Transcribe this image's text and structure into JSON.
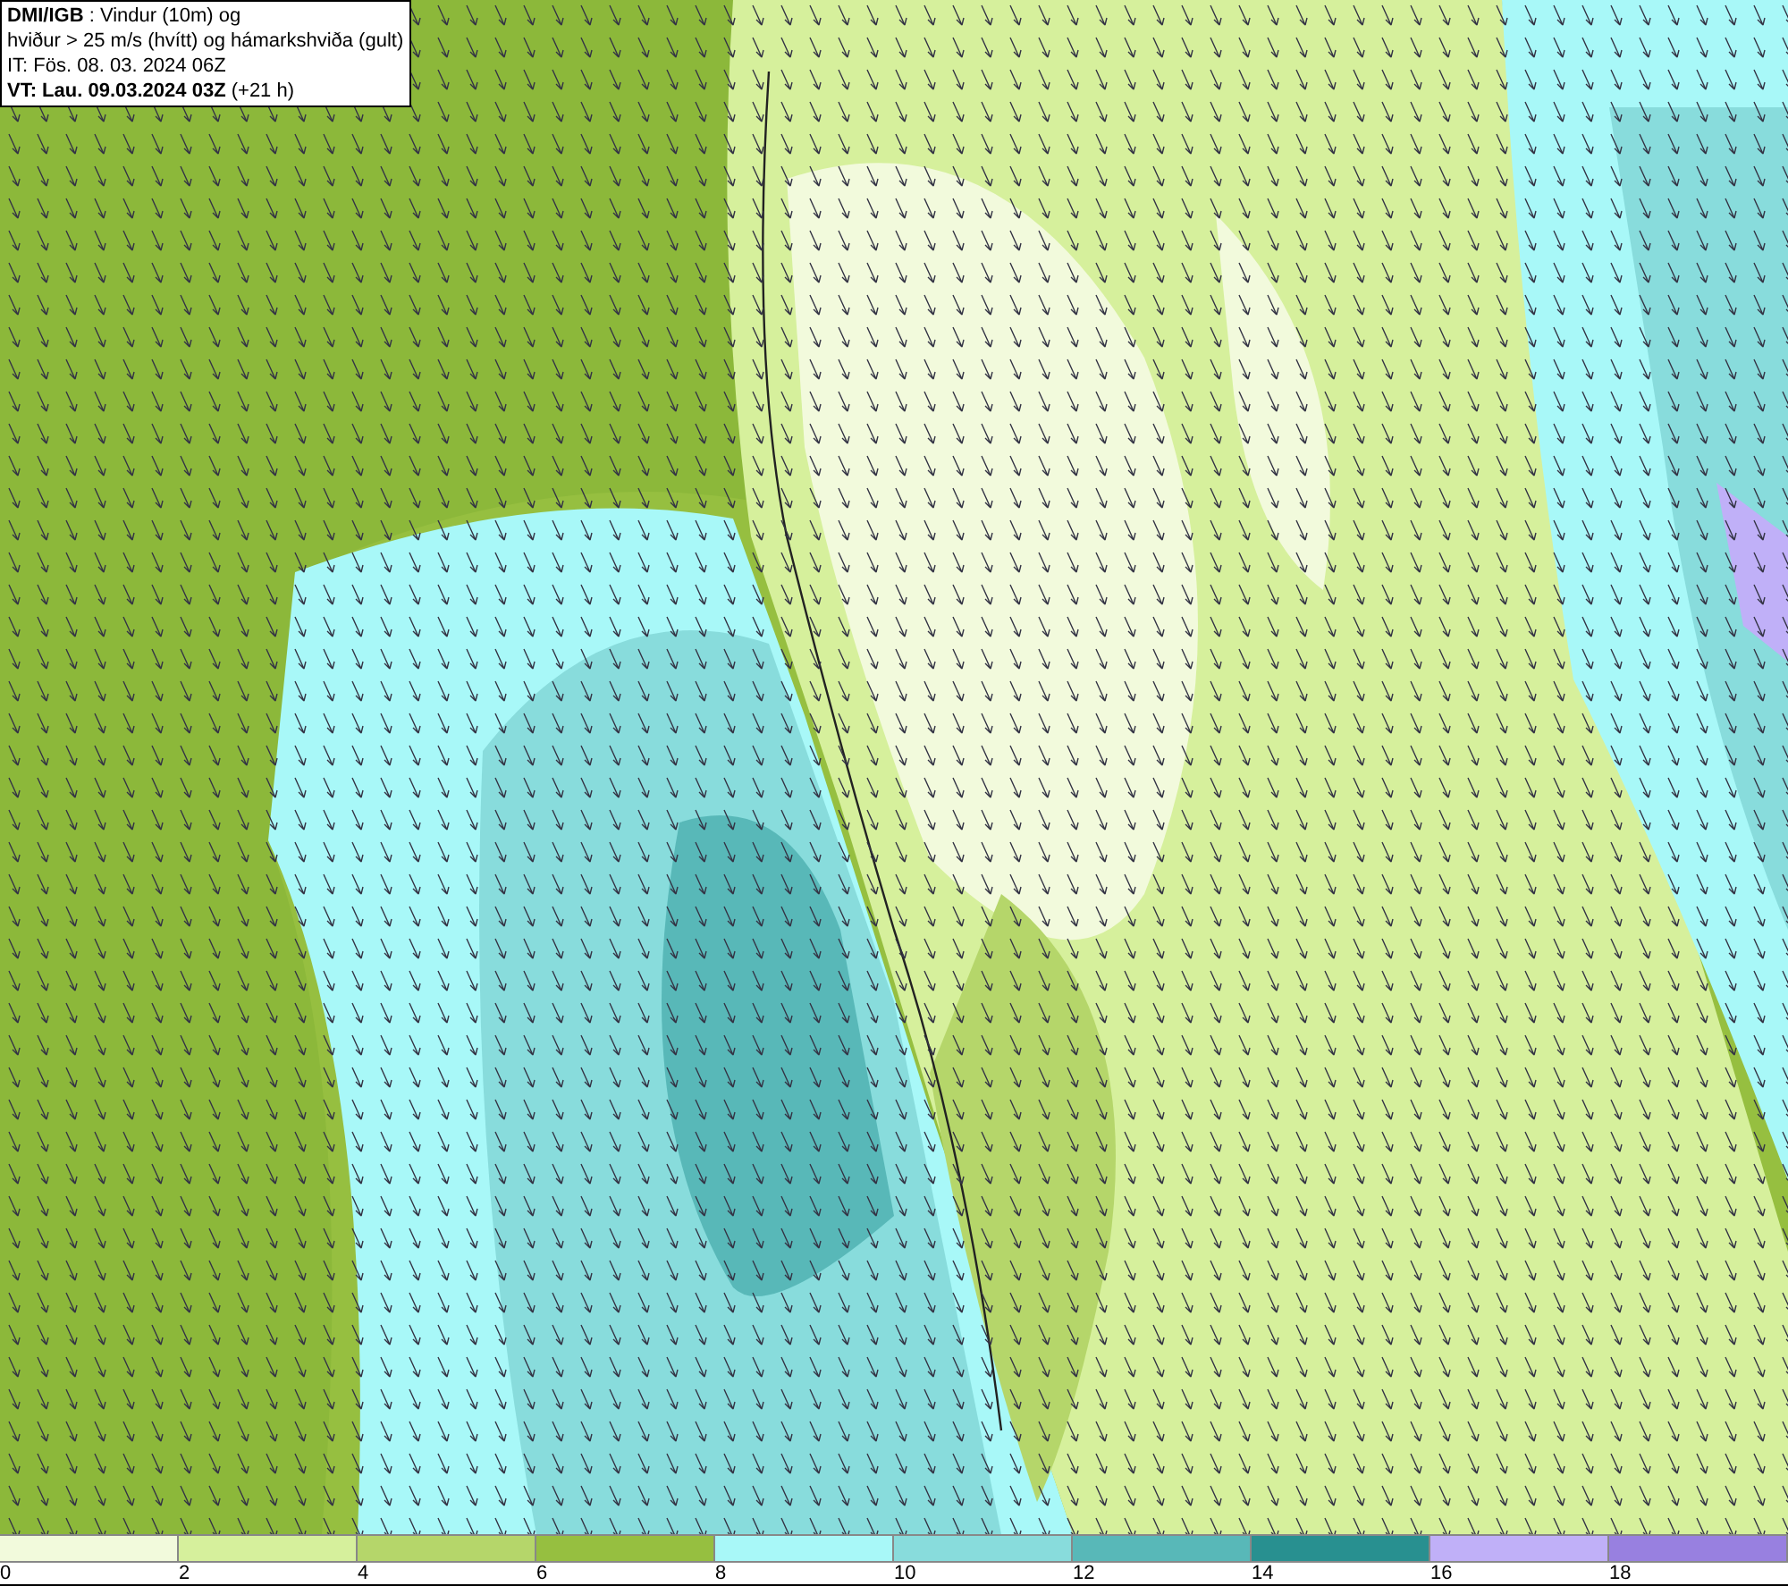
{
  "title_box": {
    "lines": [
      "**DMI/IGB** : Vindur (10m) og",
      "hviður > 25 m/s (hvítt) og hámarkshviða (gult)",
      "IT: Fös. 08. 03. 2024 06Z",
      "**VT: Lau. 09.03.2024 03Z** (+21 h)"
    ]
  },
  "legend": [
    {
      "label": "0",
      "color": "#f2fadc"
    },
    {
      "label": "2",
      "color": "#d6f09c"
    },
    {
      "label": "4",
      "color": "#b5d66a"
    },
    {
      "label": "6",
      "color": "#96bf40"
    },
    {
      "label": "8",
      "color": "#a8f8f8"
    },
    {
      "label": "10",
      "color": "#88dcdc"
    },
    {
      "label": "12",
      "color": "#58b8b8"
    },
    {
      "label": "14",
      "color": "#289090"
    },
    {
      "label": "16",
      "color": "#c0b0f8"
    },
    {
      "label": "18",
      "color": "#9880e0"
    }
  ]
}
